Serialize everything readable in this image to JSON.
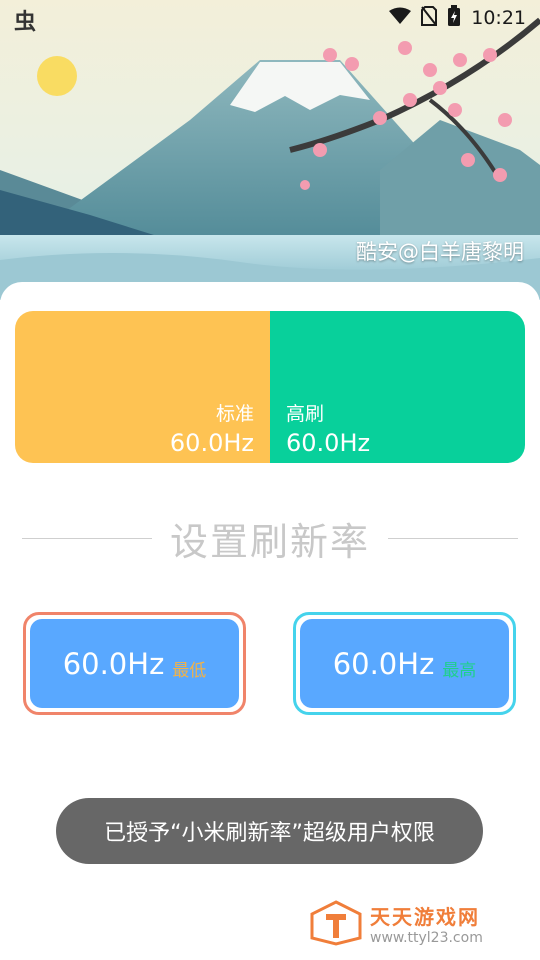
{
  "status_bar": {
    "time": "10:21",
    "app_icon_glyph": "虫",
    "icons": [
      "wifi-icon",
      "no-sim-icon",
      "battery-charging-icon"
    ]
  },
  "hero": {
    "credit": "酷安@白羊唐黎明"
  },
  "rate_panel": {
    "standard": {
      "label": "标准",
      "value": "60.0Hz",
      "color": "#fec353"
    },
    "high": {
      "label": "高刷",
      "value": "60.0Hz",
      "color": "#08d09b"
    }
  },
  "settings": {
    "title": "设置刷新率",
    "min_button": {
      "value": "60.0Hz",
      "tag": "最低",
      "border_color": "#f0846a"
    },
    "max_button": {
      "value": "60.0Hz",
      "tag": "最高",
      "border_color": "#45d3ec"
    },
    "button_color": "#59a8ff"
  },
  "toast": {
    "message": "已授予“小米刷新率”超级用户权限"
  },
  "watermark": {
    "title": "天天游戏网",
    "url": "www.ttyl23.com"
  }
}
